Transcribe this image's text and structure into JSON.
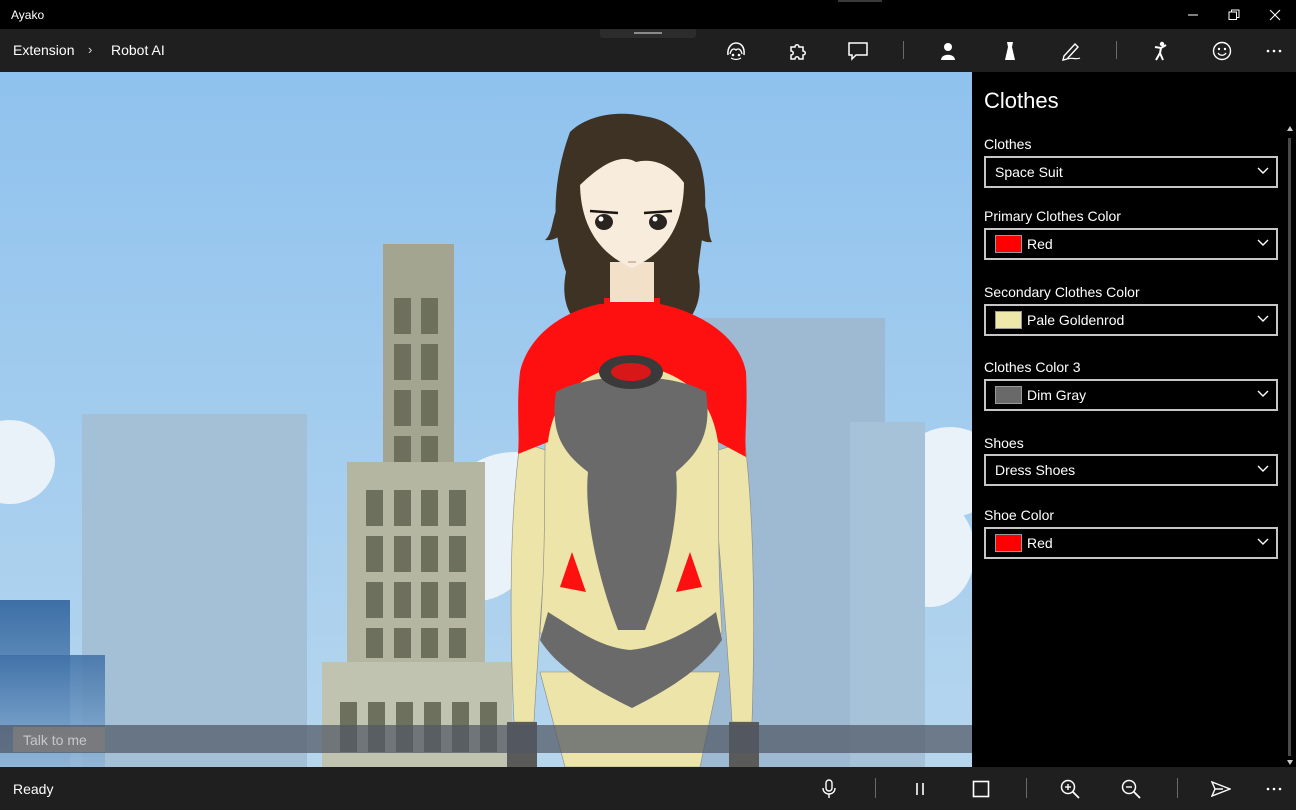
{
  "window": {
    "title": "Ayako"
  },
  "breadcrumb": {
    "root": "Extension",
    "separator": "›",
    "current": "Robot AI"
  },
  "toolbar": {
    "icons": [
      "face-outline-icon",
      "puzzle-icon",
      "chat-bubble-icon",
      "person-icon",
      "dress-icon",
      "pen-icon",
      "pose-icon",
      "smiley-icon",
      "more-icon"
    ]
  },
  "chat": {
    "placeholder": "Talk to me"
  },
  "panel": {
    "title": "Clothes",
    "fields": [
      {
        "label": "Clothes",
        "value": "Space Suit"
      },
      {
        "label": "Primary Clothes Color",
        "value": "Red",
        "color": "#ff0000"
      },
      {
        "label": "Secondary Clothes Color",
        "value": "Pale Goldenrod",
        "color": "#eee8aa"
      },
      {
        "label": "Clothes Color 3",
        "value": "Dim Gray",
        "color": "#696969"
      },
      {
        "label": "Shoes",
        "value": "Dress Shoes"
      },
      {
        "label": "Shoe Color",
        "value": "Red",
        "color": "#ff0000"
      }
    ]
  },
  "statusbar": {
    "status": "Ready",
    "icons": [
      "microphone-icon",
      "pause-icon",
      "stop-icon",
      "zoom-in-icon",
      "zoom-out-icon",
      "send-icon",
      "more-icon"
    ]
  },
  "colors": {
    "sky": "#97c6ec",
    "panel_bg": "#000000",
    "bar_bg": "#1f1f1f"
  }
}
